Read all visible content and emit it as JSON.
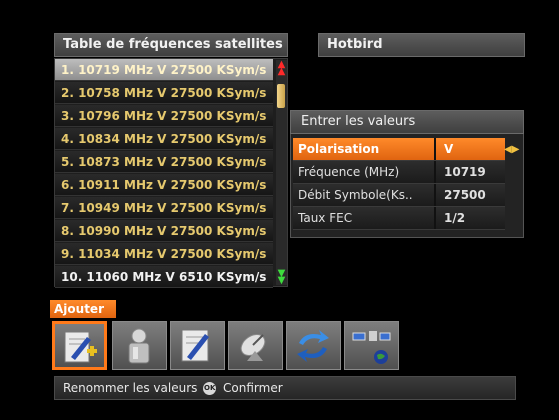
{
  "list": {
    "title": "Table de fréquences satellites",
    "items": [
      "1. 10719 MHz V 27500 KSym/s",
      "2. 10758 MHz V 27500 KSym/s",
      "3. 10796 MHz V 27500 KSym/s",
      "4. 10834 MHz V 27500 KSym/s",
      "5. 10873 MHz V 27500 KSym/s",
      "6. 10911 MHz V 27500 KSym/s",
      "7. 10949 MHz V 27500 KSym/s",
      "8. 10990 MHz V 27500 KSym/s",
      "9. 11034 MHz V 27500 KSym/s",
      "10. 11060 MHz V 6510 KSym/s"
    ]
  },
  "satellite": {
    "name": "Hotbird"
  },
  "dialog": {
    "title": "Entrer les valeurs",
    "rows": [
      {
        "label": "Polarisation",
        "value": "V"
      },
      {
        "label": "Fréquence (MHz)",
        "value": "10719"
      },
      {
        "label": "Débit Symbole(Ks..",
        "value": "27500"
      },
      {
        "label": "Taux FEC",
        "value": "1/2"
      }
    ]
  },
  "toolbar": {
    "active_label": "Ajouter",
    "buttons": [
      "add-icon",
      "fuel-tank-icon",
      "edit-icon",
      "satellite-dish-icon",
      "refresh-arrows-icon",
      "satellite-globe-icon"
    ]
  },
  "footer": {
    "hint_text": "Renommer les valeurs",
    "ok_glyph": "OK",
    "confirm_text": "Confirmer"
  },
  "colors": {
    "accent": "#ff7a1a",
    "list_text": "#e6c96e",
    "scroll_up": "#ff2a2a",
    "scroll_down": "#3ddc3d"
  }
}
